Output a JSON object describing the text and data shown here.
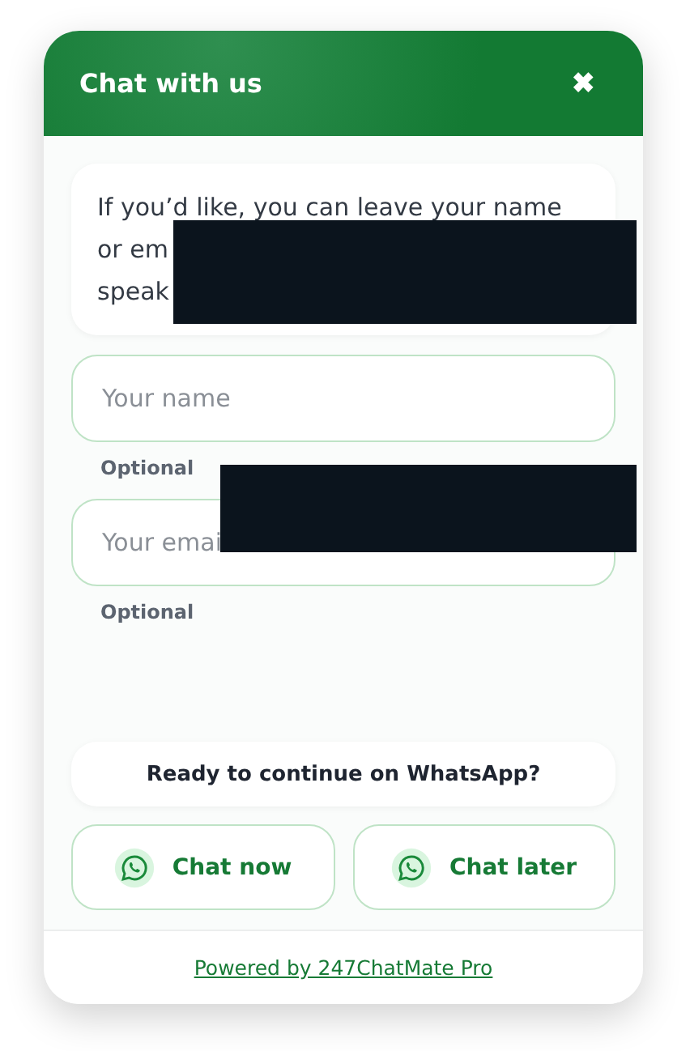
{
  "header": {
    "title": "Chat with us",
    "close": "✖"
  },
  "message": {
    "lines": [
      "If you’d like, you can leave your name",
      "or em",
      "speak"
    ]
  },
  "fields": [
    {
      "placeholder": "Your name",
      "hint": "Optional"
    },
    {
      "placeholder": "Your emai",
      "hint": "Optional"
    }
  ],
  "prompt": "Ready to continue on WhatsApp?",
  "buttons": [
    {
      "label": "Chat now"
    },
    {
      "label": "Chat later"
    }
  ],
  "footer_link": "Powered by 247ChatMate Pro"
}
